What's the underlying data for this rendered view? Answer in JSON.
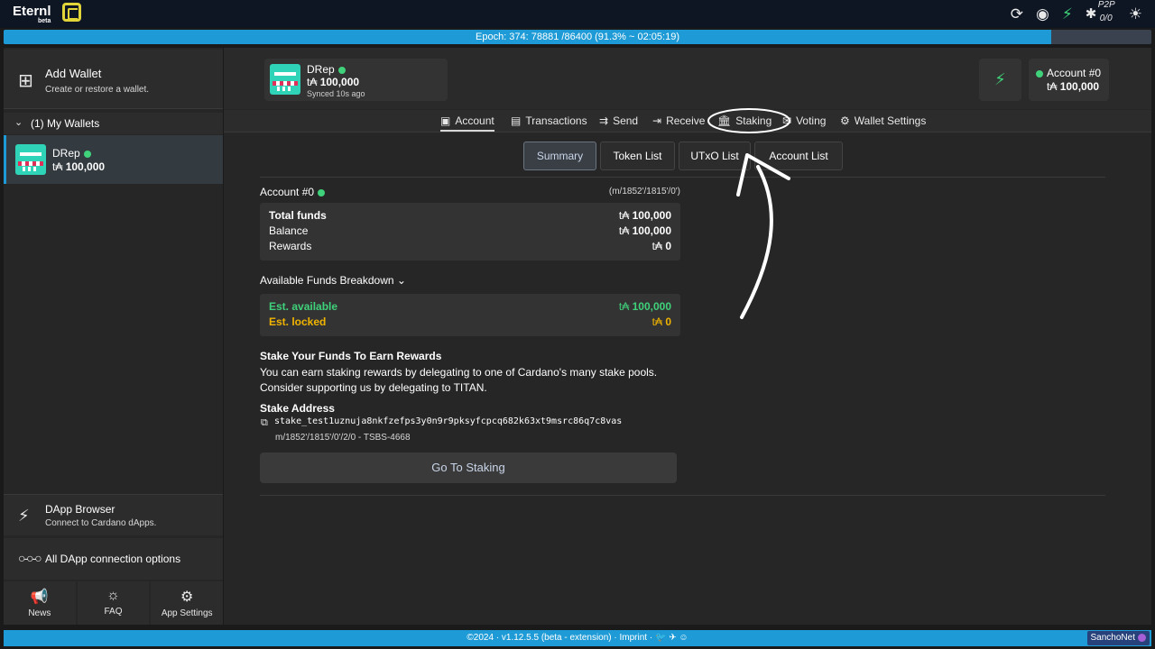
{
  "app": {
    "name": "Eternl",
    "badge": "beta"
  },
  "topbar": {
    "icons": [
      "sync-icon",
      "eye-icon",
      "connection-plug-icon",
      "p2p-plug-icon",
      "theme-sun-icon"
    ],
    "p2p_label": "P2P",
    "p2p_count": "0/0"
  },
  "epoch": {
    "text": "Epoch: 374: 78881 /86400 (91.3% ~ 02:05:19)",
    "progress_percent": 91.3,
    "colors": {
      "fill": "#1e9bd6",
      "track": "#3a4250"
    }
  },
  "sidebar": {
    "add_wallet": {
      "title": "Add Wallet",
      "subtitle": "Create or restore a wallet."
    },
    "my_wallets_label": "(1) My Wallets",
    "wallets": [
      {
        "name": "DRep",
        "currency": "t₳",
        "balance": "100,000",
        "status": "online"
      }
    ],
    "dapp_browser": {
      "title": "DApp Browser",
      "subtitle": "Connect to Cardano dApps."
    },
    "dapp_options": "All DApp connection options",
    "bottom_nav": [
      {
        "label": "News",
        "icon": "megaphone-icon"
      },
      {
        "label": "FAQ",
        "icon": "lightbulb-icon"
      },
      {
        "label": "App Settings",
        "icon": "gear-icon"
      }
    ]
  },
  "header": {
    "wallet": {
      "name": "DRep",
      "currency": "t₳",
      "balance": "100,000",
      "sync": "Synced 10s ago"
    },
    "account": {
      "name": "Account #0",
      "currency": "t₳",
      "balance": "100,000"
    }
  },
  "tabs": [
    {
      "label": "Account",
      "icon": "wallet-icon",
      "active": true
    },
    {
      "label": "Transactions",
      "icon": "list-icon"
    },
    {
      "label": "Send",
      "icon": "send-icon"
    },
    {
      "label": "Receive",
      "icon": "receive-icon"
    },
    {
      "label": "Staking",
      "icon": "bank-icon"
    },
    {
      "label": "Voting",
      "icon": "ballot-icon"
    },
    {
      "label": "Wallet Settings",
      "icon": "gear-icon"
    }
  ],
  "subtabs": [
    "Summary",
    "Token List",
    "UTxO List",
    "Account List"
  ],
  "summary": {
    "account_title": "Account #0",
    "derivation_path": "(m/1852'/1815'/0')",
    "funds": [
      {
        "label": "Total funds",
        "currency": "t₳",
        "value": "100,000"
      },
      {
        "label": "Balance",
        "currency": "t₳",
        "value": "100,000"
      },
      {
        "label": "Rewards",
        "currency": "t₳",
        "value": "0"
      }
    ],
    "breakdown_label": "Available Funds Breakdown",
    "breakdown": [
      {
        "label": "Est. available",
        "currency": "t₳",
        "value": "100,000",
        "color": "#3fd27a"
      },
      {
        "label": "Est. locked",
        "currency": "t₳",
        "value": "0",
        "color": "#f0b400"
      }
    ],
    "stake_title": "Stake Your Funds To Earn Rewards",
    "stake_desc_1": "You can earn staking rewards by delegating to one of Cardano's many stake pools.",
    "stake_desc_2": "Consider supporting us by delegating to TITAN.",
    "stake_address_label": "Stake Address",
    "stake_address": "stake_test1uznuja8nkfzefps3y0n9r9pksyfcpcq682k63xt9msrc86q7c8vas",
    "stake_path": "m/1852'/1815'/0'/2/0 - TSBS-4668",
    "goto_button": "Go To Staking"
  },
  "footer": {
    "text": "©2024 · v1.12.5.5 (beta - extension) · Imprint ·",
    "network": "SanchoNet"
  }
}
